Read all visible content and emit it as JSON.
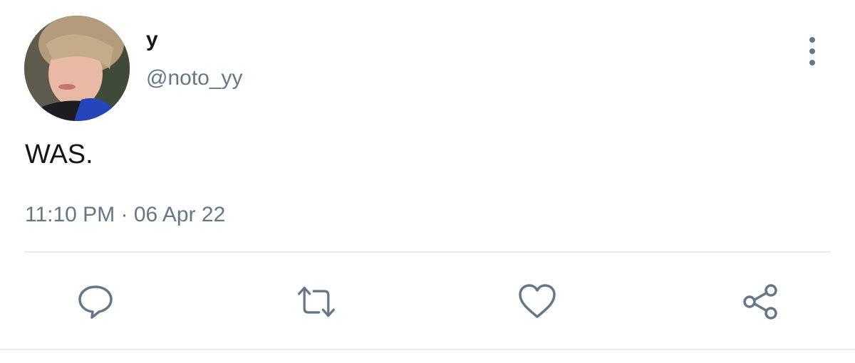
{
  "tweet": {
    "display_name": "y",
    "handle": "@noto_yy",
    "text": "WAS.",
    "timestamp": "11:10 PM · 06 Apr 22"
  },
  "actions": {
    "reply_icon": "speech-bubble-icon",
    "retweet_icon": "retweet-arrows-icon",
    "like_icon": "heart-icon",
    "share_icon": "share-nodes-icon"
  },
  "colors": {
    "text_primary": "#14171a",
    "text_secondary": "#657786",
    "divider": "#e6ecf0"
  }
}
